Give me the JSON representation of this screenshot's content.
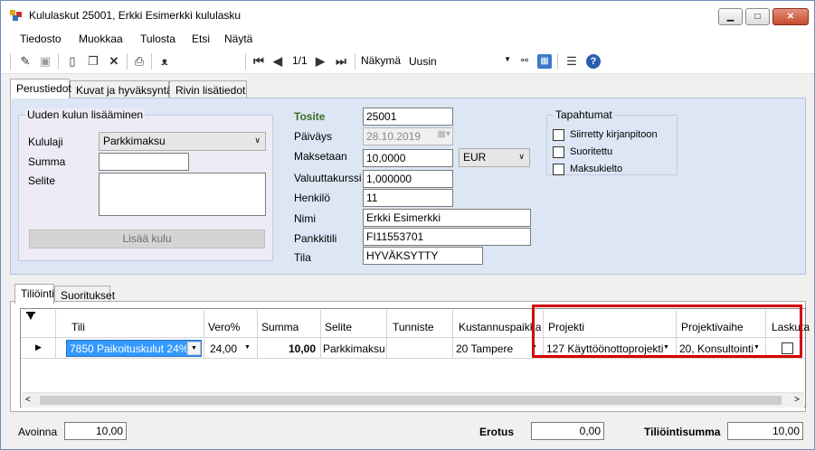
{
  "window": {
    "title": "Kululaskut 25001, Erkki Esimerkki kululasku",
    "minimize": "▁",
    "maximize": "□",
    "close": "✕"
  },
  "menu": [
    "Tiedosto",
    "Muokkaa",
    "Tulosta",
    "Etsi",
    "Näytä"
  ],
  "toolbar": {
    "pager": "1/1",
    "view_label": "Näkymä",
    "view_value": "Uusin"
  },
  "tabs_top": [
    "Perustiedot",
    "Kuvat ja hyväksyntä",
    "Rivin lisätiedot"
  ],
  "new_expense": {
    "title": "Uuden kulun lisääminen",
    "type_label": "Kululaji",
    "type_value": "Parkkimaksu",
    "sum_label": "Summa",
    "sum_value": "",
    "desc_label": "Selite",
    "desc_value": "",
    "add_button": "Lisää kulu"
  },
  "voucher": {
    "tosite_label": "Tosite",
    "tosite_value": "25001",
    "date_label": "Päiväys",
    "date_value": "28.10.2019",
    "paid_label": "Maksetaan",
    "paid_value": "10,0000",
    "currency": "EUR",
    "rate_label": "Valuuttakurssi",
    "rate_value": "1,000000",
    "person_label": "Henkilö",
    "person_value": "11",
    "name_label": "Nimi",
    "name_value": "Erkki Esimerkki",
    "bank_label": "Pankkitili",
    "bank_value": "FI11553701",
    "state_label": "Tila",
    "state_value": "HYVÄKSYTTY"
  },
  "events": {
    "title": "Tapahtumat",
    "items": [
      {
        "label": "Siirretty kirjanpitoon",
        "checked": false
      },
      {
        "label": "Suoritettu",
        "checked": false
      },
      {
        "label": "Maksukielto",
        "checked": false
      }
    ]
  },
  "tabs_bottom": [
    "Tiliöinti",
    "Suoritukset"
  ],
  "grid": {
    "headers": [
      "Tili",
      "Vero%",
      "Summa",
      "Selite",
      "Tunniste",
      "Kustannuspaikka",
      "Projekti",
      "Projektivaihe",
      "Laskuta"
    ],
    "row": {
      "tili": "7850 Paikoituskulut 24%",
      "vero": "24,00",
      "summa": "10,00",
      "selite": "Parkkimaksu",
      "tunniste": "",
      "kustannuspaikka": "20 Tampere",
      "projekti": "127 Käyttöönottoprojekti",
      "projektivaihe": "20, Konsultointi",
      "laskuta": false
    }
  },
  "footer": {
    "open_label": "Avoinna",
    "open_value": "10,00",
    "diff_label": "Erotus",
    "diff_value": "0,00",
    "sum_label": "Tiliöintisumma",
    "sum_value": "10,00"
  }
}
